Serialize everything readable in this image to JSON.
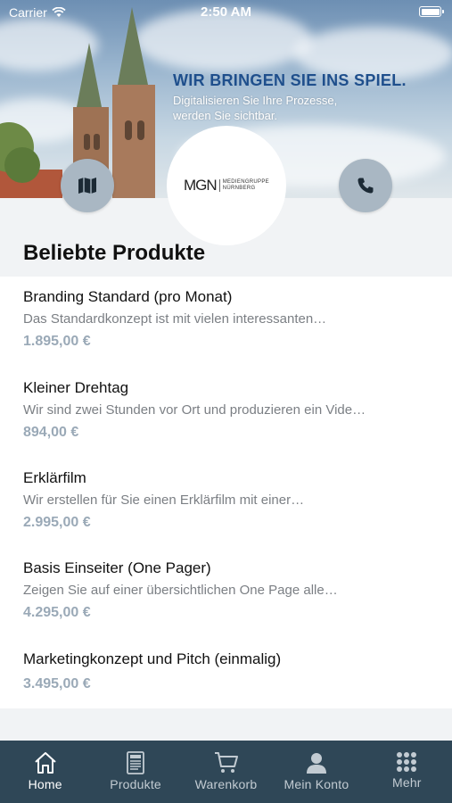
{
  "status_bar": {
    "carrier": "Carrier",
    "time": "2:50 AM"
  },
  "hero": {
    "headline": "WIR BRINGEN SIE INS SPIEL.",
    "subline_1": "Digitalisieren Sie Ihre Prozesse,",
    "subline_2": "werden Sie sichtbar.",
    "logo_mark": "MGN",
    "logo_sub_1": "MEDIENGRUPPE",
    "logo_sub_2": "NÜRNBERG",
    "left_button_icon": "map-icon",
    "right_button_icon": "phone-icon"
  },
  "section_title": "Beliebte Produkte",
  "products": [
    {
      "name": "Branding Standard (pro Monat)",
      "desc": "Das Standardkonzept ist mit vielen interessanten…",
      "price": "1.895,00 €"
    },
    {
      "name": "Kleiner Drehtag",
      "desc": "Wir sind zwei Stunden vor Ort und produzieren ein Vide…",
      "price": "894,00 €"
    },
    {
      "name": "Erklärfilm",
      "desc": "Wir erstellen für Sie einen Erklärfilm mit einer…",
      "price": "2.995,00 €"
    },
    {
      "name": "Basis Einseiter (One Pager)",
      "desc": "Zeigen Sie auf einer übersichtlichen One Page alle…",
      "price": "4.295,00 €"
    },
    {
      "name": "Marketingkonzept und Pitch (einmalig)",
      "desc": "",
      "price": "3.495,00 €"
    }
  ],
  "tabs": [
    {
      "label": "Home",
      "icon": "home-icon",
      "active": true
    },
    {
      "label": "Produkte",
      "icon": "menu-card-icon",
      "active": false
    },
    {
      "label": "Warenkorb",
      "icon": "cart-icon",
      "active": false
    },
    {
      "label": "Mein Konto",
      "icon": "user-icon",
      "active": false
    },
    {
      "label": "Mehr",
      "icon": "grid-icon",
      "active": false
    }
  ],
  "colors": {
    "tab_bar_bg": "#2f4757",
    "price": "#9aa9b7",
    "headline": "#1f4f8c",
    "hero_button": "#a9b7c3"
  }
}
